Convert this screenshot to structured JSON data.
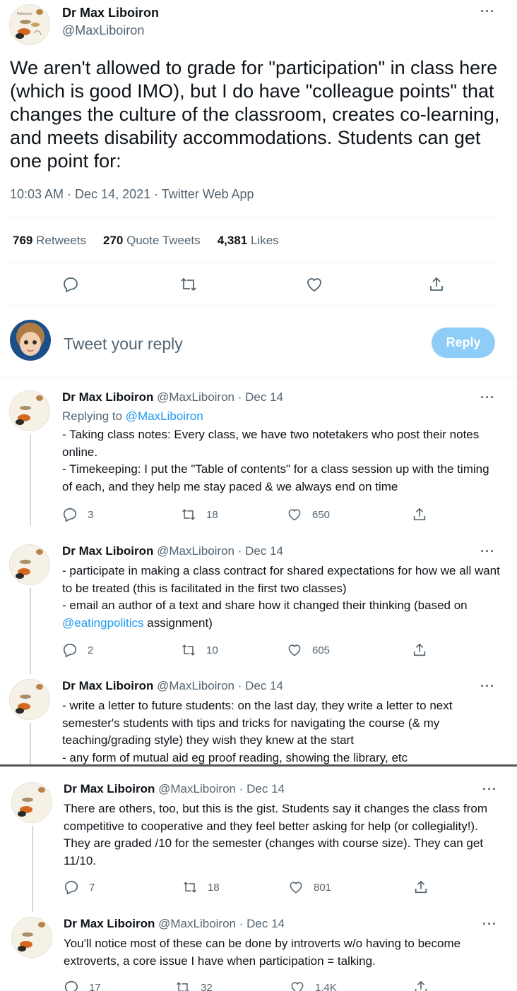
{
  "main": {
    "name": "Dr Max Liboiron",
    "handle": "@MaxLiboiron",
    "text": "We aren't allowed to grade for \"participation\" in class here (which is good IMO), but I do have \"colleague points\" that changes the culture of the classroom, creates co-learning, and meets disability accommodations. Students can get one point for:",
    "meta": "10:03 AM · Dec 14, 2021 · Twitter Web App",
    "stats": {
      "retweets_count": "769",
      "retweets_label": "Retweets",
      "quotes_count": "270",
      "quotes_label": "Quote Tweets",
      "likes_count": "4,381",
      "likes_label": "Likes"
    }
  },
  "compose": {
    "placeholder": "Tweet your reply",
    "button": "Reply"
  },
  "replies": [
    {
      "name": "Dr Max Liboiron",
      "handle_date": "@MaxLiboiron · Dec 14",
      "replying_label": "Replying to ",
      "replying_handle": "@MaxLiboiron",
      "line1": "- Taking class notes: Every class, we have two notetakers who post their notes online.",
      "line2": "- Timekeeping: I put the \"Table of contents\" for a class session up with the timing of each, and they help me stay paced & we always end on time",
      "replies": "3",
      "retweets": "18",
      "likes": "650"
    },
    {
      "name": "Dr Max Liboiron",
      "handle_date": "@MaxLiboiron · Dec 14",
      "line1": "- participate in making a class contract for shared expectations for how we all want to be treated (this is facilitated in the first two classes)",
      "line2a": "- email an author of a text and share how it changed their thinking (based on ",
      "line2_link": "@eatingpolitics",
      "line2b": " assignment)",
      "replies": "2",
      "retweets": "10",
      "likes": "605"
    },
    {
      "name": "Dr Max Liboiron",
      "handle_date": "@MaxLiboiron · Dec 14",
      "line1": "- write a letter to future students: on the last day, they write a letter to next semester's students with tips and tricks for navigating the course (& my teaching/grading style) they wish they knew at the start",
      "line2": "- any form of mutual aid eg proof reading, showing the library, etc"
    },
    {
      "name": "Dr Max Liboiron",
      "handle_date": "@MaxLiboiron · Dec 14",
      "text": "There are others, too, but this is the gist. Students say it changes the class from competitive to cooperative and they feel better asking for help (or collegiality!). They are graded /10 for the semester (changes with course size). They can get 11/10.",
      "replies": "7",
      "retweets": "18",
      "likes": "801"
    },
    {
      "name": "Dr Max Liboiron",
      "handle_date": "@MaxLiboiron · Dec 14",
      "text": "You'll notice most of these can be done by introverts w/o having to become extroverts, a core issue I have when participation = talking.",
      "replies": "17",
      "retweets": "32",
      "likes": "1.4K"
    }
  ],
  "colors": {
    "accent": "#1d9bf0",
    "reply_button_bg": "#8ecdf8",
    "text": "#0f1419",
    "secondary": "#536471",
    "divider": "#eff3f4"
  },
  "icons": [
    "more-icon",
    "reply-icon",
    "retweet-icon",
    "like-icon",
    "share-icon"
  ]
}
